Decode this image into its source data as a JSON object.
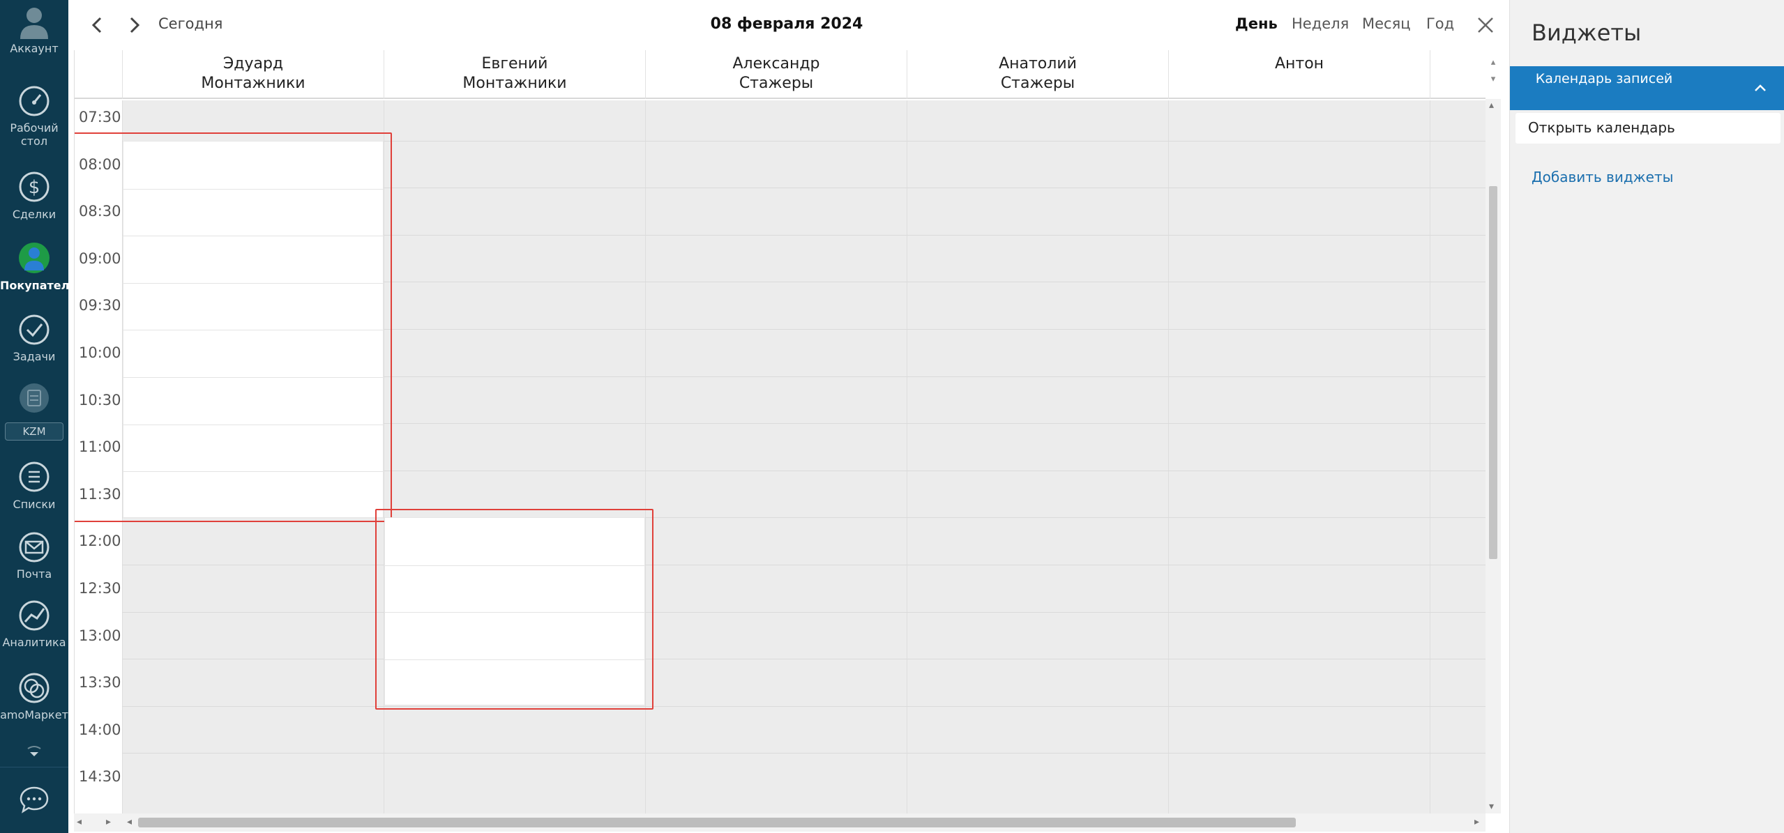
{
  "nav": {
    "account": "Аккаунт",
    "dashboard_line1": "Рабочий",
    "dashboard_line2": "стол",
    "deals": "Сделки",
    "customers": "Покупатели",
    "tasks": "Задачи",
    "kzm": "KZM",
    "lists": "Списки",
    "mail": "Почта",
    "analytics": "Аналитика",
    "amomarket": "amoМаркет"
  },
  "topbar": {
    "today": "Сегодня",
    "date": "08 февраля 2024",
    "views": [
      "День",
      "Неделя",
      "Месяц",
      "Год"
    ],
    "active_view": "День"
  },
  "columns": [
    {
      "name": "Эдуард",
      "group": "Монтажники"
    },
    {
      "name": "Евгений",
      "group": "Монтажники"
    },
    {
      "name": "Александр",
      "group": "Стажеры"
    },
    {
      "name": "Анатолий",
      "group": "Стажеры"
    },
    {
      "name": "Антон",
      "group": ""
    }
  ],
  "times": [
    "07:30",
    "08:00",
    "08:30",
    "09:00",
    "09:30",
    "10:00",
    "10:30",
    "11:00",
    "11:30",
    "12:00",
    "12:30",
    "13:00",
    "13:30",
    "14:00",
    "14:30"
  ],
  "availability": [
    {
      "column": "Эдуард",
      "start": "08:00",
      "end": "12:00"
    },
    {
      "column": "Евгений",
      "start": "12:00",
      "end": "14:00"
    }
  ],
  "right_panel": {
    "title": "Виджеты",
    "widget_name": "Календарь записей",
    "open_calendar": "Открыть календарь",
    "add_widgets": "Добавить виджеты"
  },
  "colors": {
    "nav_bg": "#0e3a4f",
    "accent": "#1b7cc1",
    "highlight": "#e0403a",
    "link": "#1b6fae"
  }
}
